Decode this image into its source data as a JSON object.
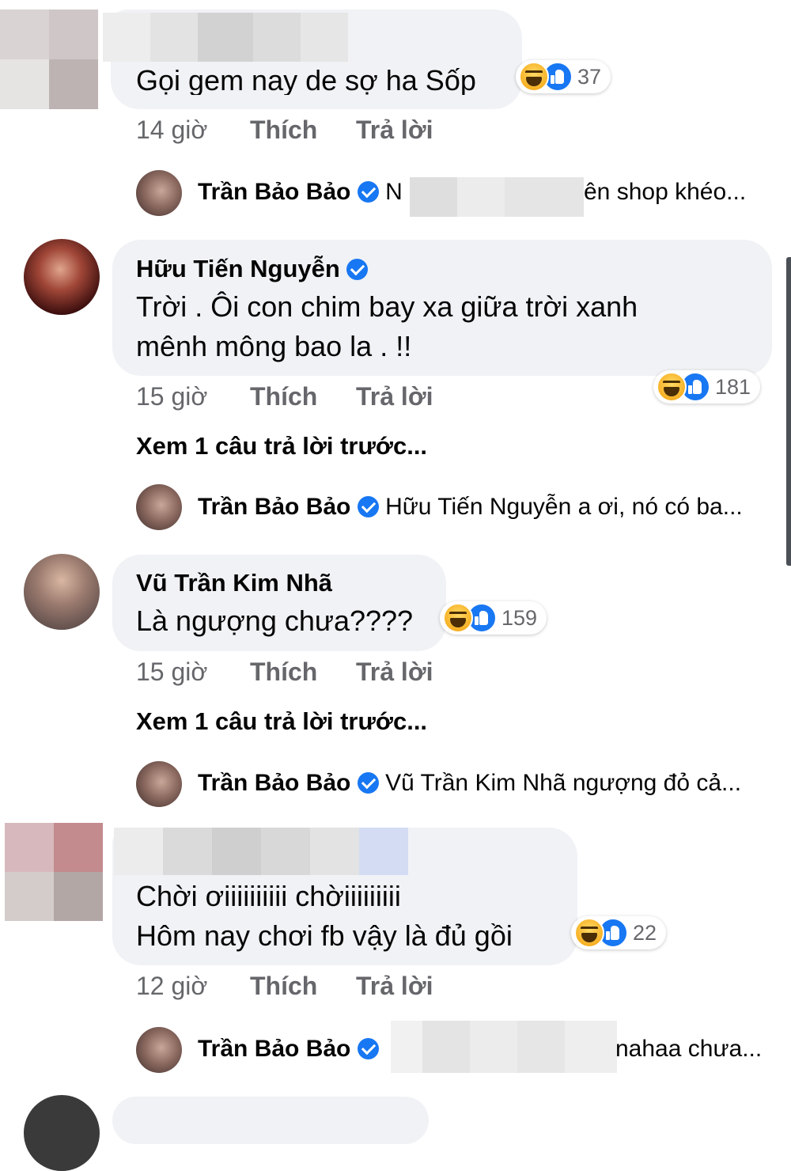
{
  "colors": {
    "bubble_bg": "#f0f2f5",
    "meta_text": "#65676b",
    "verified_blue": "#1877f2",
    "name_text": "#050505"
  },
  "labels": {
    "like": "Thích",
    "reply": "Trả lời",
    "view_previous": "Xem 1 câu trả lời trước..."
  },
  "comments": [
    {
      "author": "",
      "author_censored": true,
      "text_lines": [
        "Gọi gem nay de sợ ha Sốp"
      ],
      "time": "14 giờ",
      "reaction_count": "37",
      "reactions": [
        "haha-icon",
        "like-icon"
      ],
      "reply": {
        "author": "Trần Bảo Bảo",
        "verified": true,
        "text_start": "N",
        "text_end": "ên shop khéo..."
      }
    },
    {
      "author": "Hữu Tiến Nguyễn",
      "verified": true,
      "text_lines": [
        "Trời . Ôi con chim bay xa giữa trời xanh",
        "mênh mông bao la . !!"
      ],
      "time": "15 giờ",
      "reaction_count": "181",
      "reactions": [
        "haha-icon",
        "like-icon"
      ],
      "view_previous": "Xem 1 câu trả lời trước...",
      "reply": {
        "author": "Trần Bảo Bảo",
        "verified": true,
        "text": "Hữu Tiến Nguyễn a ơi, nó có ba..."
      }
    },
    {
      "author": "Vũ Trần Kim Nhã",
      "verified": false,
      "text_lines": [
        "Là ngượng chưa????"
      ],
      "time": "15 giờ",
      "reaction_count": "159",
      "reactions": [
        "haha-icon",
        "like-icon"
      ],
      "view_previous": "Xem 1 câu trả lời trước...",
      "reply": {
        "author": "Trần Bảo Bảo",
        "verified": true,
        "text": "Vũ Trần Kim Nhã ngượng đỏ cả..."
      }
    },
    {
      "author": "",
      "author_censored": true,
      "text_lines": [
        "Chời ơiiiiiiiiii chờiiiiiiiii",
        "Hôm nay chơi fb vậy là đủ gồi"
      ],
      "time": "12 giờ",
      "reaction_count": "22",
      "reactions": [
        "haha-icon",
        "like-icon"
      ],
      "reply": {
        "author": "Trần Bảo Bảo",
        "verified": true,
        "text_end": "nahaa chưa..."
      }
    }
  ]
}
